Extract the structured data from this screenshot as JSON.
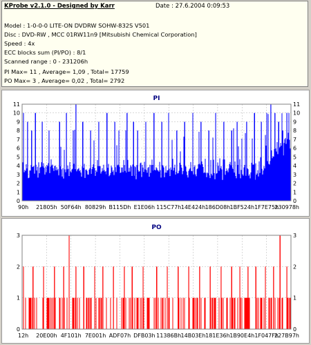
{
  "header": {
    "title": "KProbe v2.1.0 - Designed by Karr",
    "date": "Date : 27.6.2004 0:09:53"
  },
  "info_lines": [
    "Model : 1-0-0-0 LITE-ON DVDRW SOHW-832S  V501",
    "Disc : DVD-RW , MCC 01RW11n9 [Mitsubishi Chemical Corporation]",
    "Speed : 4x",
    "ECC blocks sum (PI/PO) : 8/1",
    "Scanned range : 0 - 231206h",
    "PI Max= 11 , Average= 1,09 , Total= 17759",
    "PO Max= 3 , Average= 0,02 , Total= 2792"
  ],
  "colors": {
    "pi": "#0000ff",
    "po": "#ff0000",
    "grid": "#b0b0b0",
    "title": "#000080",
    "background": "#ffffff"
  },
  "chart_data": [
    {
      "type": "bar",
      "title": "PI",
      "ylim": [
        0,
        11
      ],
      "yticks": [
        0,
        1,
        2,
        3,
        4,
        5,
        6,
        7,
        8,
        9,
        10,
        11
      ],
      "xticks": [
        "90h",
        "21805h",
        "50F64h",
        "80829h",
        "B115Dh",
        "E1E06h",
        "115C77h",
        "14E424h",
        "186D08h",
        "1BF524h",
        "1F7E75h",
        "230978h"
      ],
      "grid": true,
      "series": [
        {
          "peaks": [
            [
              0.005,
              10
            ],
            [
              0.02,
              9
            ],
            [
              0.035,
              8
            ],
            [
              0.05,
              10
            ],
            [
              0.075,
              9
            ],
            [
              0.1,
              8
            ],
            [
              0.14,
              9
            ],
            [
              0.165,
              10
            ],
            [
              0.19,
              8
            ],
            [
              0.2,
              11
            ],
            [
              0.225,
              9
            ],
            [
              0.255,
              8
            ],
            [
              0.285,
              9
            ],
            [
              0.315,
              10
            ],
            [
              0.345,
              9
            ],
            [
              0.36,
              8
            ],
            [
              0.39,
              10
            ],
            [
              0.415,
              9
            ],
            [
              0.43,
              8
            ],
            [
              0.46,
              9
            ],
            [
              0.49,
              10
            ],
            [
              0.52,
              9
            ],
            [
              0.545,
              10
            ],
            [
              0.575,
              8
            ],
            [
              0.605,
              9
            ],
            [
              0.635,
              10
            ],
            [
              0.665,
              9
            ],
            [
              0.695,
              8
            ],
            [
              0.72,
              10
            ],
            [
              0.75,
              9
            ],
            [
              0.78,
              8
            ],
            [
              0.8,
              9
            ],
            [
              0.835,
              9
            ],
            [
              0.865,
              10
            ],
            [
              0.89,
              9
            ],
            [
              0.91,
              10
            ],
            [
              0.925,
              11
            ],
            [
              0.94,
              10
            ],
            [
              0.955,
              9
            ],
            [
              0.97,
              8
            ],
            [
              0.985,
              10
            ]
          ]
        }
      ]
    },
    {
      "type": "bar",
      "title": "PO",
      "ylim": [
        0,
        3
      ],
      "yticks": [
        0,
        1,
        2,
        3
      ],
      "xticks": [
        "12h",
        "20E00h",
        "4F101h",
        "7E001h",
        "ADF07h",
        "DFB03h",
        "11386Bh",
        "14B03Eh",
        "181E36h",
        "1B90E4h",
        "1F047Fh",
        "227B97h"
      ],
      "grid": true,
      "series": [
        {
          "peaks": [
            [
              0.005,
              2
            ],
            [
              0.04,
              2
            ],
            [
              0.08,
              2
            ],
            [
              0.12,
              2
            ],
            [
              0.155,
              2
            ],
            [
              0.175,
              3
            ],
            [
              0.2,
              2
            ],
            [
              0.23,
              2
            ],
            [
              0.27,
              2
            ],
            [
              0.3,
              2
            ],
            [
              0.34,
              2
            ],
            [
              0.38,
              2
            ],
            [
              0.41,
              2
            ],
            [
              0.45,
              2
            ],
            [
              0.5,
              2
            ],
            [
              0.54,
              2
            ],
            [
              0.58,
              2
            ],
            [
              0.62,
              2
            ],
            [
              0.66,
              2
            ],
            [
              0.7,
              2
            ],
            [
              0.74,
              2
            ],
            [
              0.78,
              2
            ],
            [
              0.81,
              2
            ],
            [
              0.84,
              2
            ],
            [
              0.87,
              2
            ],
            [
              0.905,
              2
            ],
            [
              0.935,
              2
            ],
            [
              0.96,
              3
            ],
            [
              0.985,
              2
            ]
          ]
        }
      ]
    }
  ]
}
